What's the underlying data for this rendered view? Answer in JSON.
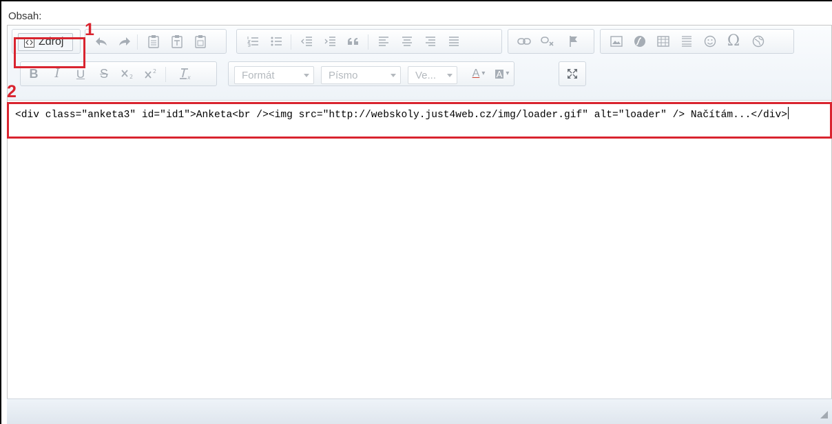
{
  "caption": "Obsah:",
  "toolbar": {
    "source_button": "Zdroj",
    "format_combo": "Formát",
    "font_combo": "Písmo",
    "size_combo": "Ve...",
    "text_color_glyph": "A",
    "bg_color_glyph": "A",
    "omega_glyph": "Ω"
  },
  "annotations": {
    "marker_1": "1",
    "marker_2": "2",
    "accent_color": "#d9242f"
  },
  "code": {
    "line": "<div class=\"anketa3\" id=\"id1\">Anketa<br /><img src=\"http://webskoly.just4web.cz/img/loader.gif\" alt=\"loader\" /> Načítám...</div>"
  },
  "icons": [
    "source-icon",
    "undo-icon",
    "redo-icon",
    "paste-icon",
    "paste-text-icon",
    "paste-word-icon",
    "numbered-list-icon",
    "bulleted-list-icon",
    "outdent-icon",
    "indent-icon",
    "blockquote-icon",
    "align-left-icon",
    "align-center-icon",
    "align-right-icon",
    "justify-icon",
    "link-icon",
    "unlink-icon",
    "anchor-icon",
    "image-icon",
    "flash-icon",
    "table-icon",
    "horizontal-rule-icon",
    "smiley-icon",
    "special-char-icon",
    "iframe-icon",
    "bold-icon",
    "italic-icon",
    "underline-icon",
    "strikethrough-icon",
    "subscript-icon",
    "superscript-icon",
    "remove-format-icon",
    "maximize-icon"
  ]
}
